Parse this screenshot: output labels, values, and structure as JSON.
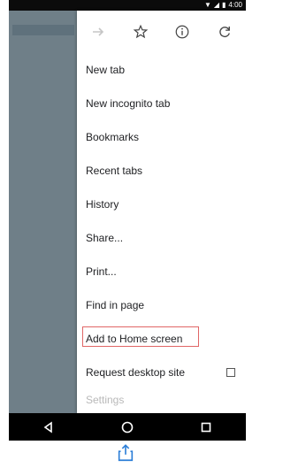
{
  "status": {
    "time": "4:00"
  },
  "menu": {
    "toolbar": {
      "back_icon": "arrow-right-icon",
      "bookmark_icon": "star-icon",
      "info_icon": "info-icon",
      "reload_icon": "reload-icon"
    },
    "items": [
      {
        "label": "New tab"
      },
      {
        "label": "New incognito tab"
      },
      {
        "label": "Bookmarks"
      },
      {
        "label": "Recent tabs"
      },
      {
        "label": "History"
      },
      {
        "label": "Share..."
      },
      {
        "label": "Print..."
      },
      {
        "label": "Find in page"
      },
      {
        "label": "Add to Home screen",
        "highlighted": true
      },
      {
        "label": "Request desktop site",
        "has_checkbox": true,
        "checked": false
      },
      {
        "label": "Settings"
      }
    ]
  },
  "colors": {
    "highlight_border": "#e06666",
    "share_icon": "#2d7fd8"
  }
}
